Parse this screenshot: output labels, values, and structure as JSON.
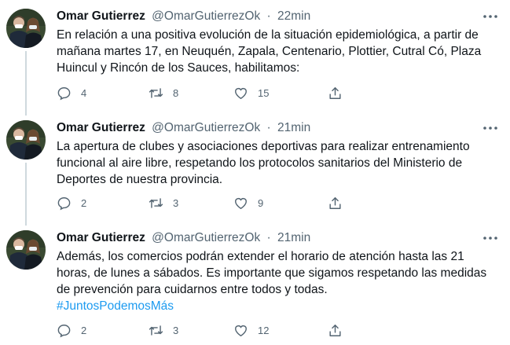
{
  "colors": {
    "text": "#0f1419",
    "secondary": "#536471",
    "link": "#1d9bf0",
    "thread_line": "#cfd9de"
  },
  "icons": [
    "avatar-photo",
    "more-icon",
    "reply-icon",
    "retweet-icon",
    "like-icon",
    "share-icon"
  ],
  "tweets": [
    {
      "name": "Omar Gutierrez",
      "handle": "@OmarGutierrezOk",
      "separator": "·",
      "time": "22min",
      "text": "En relación a una positiva evolución de la situación epidemiológica, a partir de mañana martes 17, en Neuquén, Zapala, Centenario, Plottier, Cutral Có, Plaza Huincul y Rincón de los Sauces, habilitamos:",
      "hashtag": "",
      "replies": "4",
      "retweets": "8",
      "likes": "15"
    },
    {
      "name": "Omar Gutierrez",
      "handle": "@OmarGutierrezOk",
      "separator": "·",
      "time": "21min",
      "text": "La apertura de clubes y asociaciones deportivas para realizar entrenamiento funcional al aire libre, respetando los protocolos sanitarios del Ministerio de Deportes de nuestra provincia.",
      "hashtag": "",
      "replies": "2",
      "retweets": "3",
      "likes": "9"
    },
    {
      "name": "Omar Gutierrez",
      "handle": "@OmarGutierrezOk",
      "separator": "·",
      "time": "21min",
      "text": "Además, los comercios podrán extender el horario de atención hasta las 21 horas, de lunes a sábados. Es importante que sigamos respetando las medidas de prevención para cuidarnos entre todos y todas.",
      "hashtag": "#JuntosPodemosMás",
      "replies": "2",
      "retweets": "3",
      "likes": "12"
    }
  ]
}
